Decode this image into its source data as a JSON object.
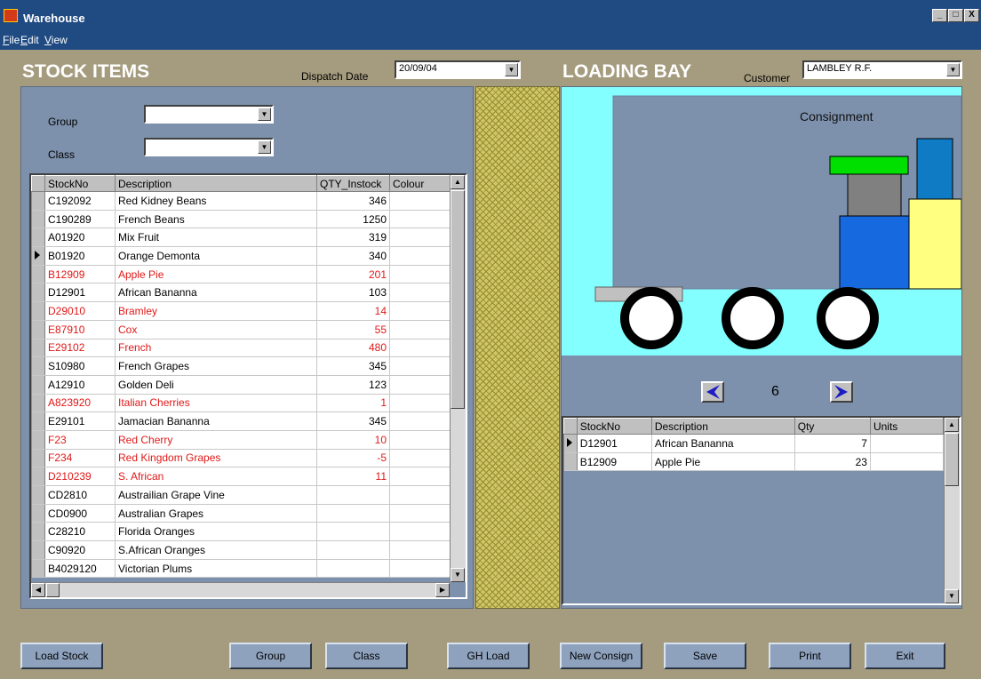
{
  "window": {
    "title": "Warehouse",
    "controls": [
      "_",
      "□",
      "X"
    ]
  },
  "menu": [
    {
      "label": "File",
      "accel": "F",
      "rest": "ile"
    },
    {
      "label": "Edit",
      "accel": "E",
      "rest": "dit"
    },
    {
      "label": "View",
      "accel": "V",
      "rest": "iew"
    }
  ],
  "stock": {
    "heading": "STOCK ITEMS",
    "dispatch_label": "Dispatch Date",
    "dispatch_value": "20/09/04",
    "group_label": "Group",
    "group_value": "",
    "class_label": "Class",
    "class_value": "",
    "columns": [
      "StockNo",
      "Description",
      "QTY_Instock",
      "Colour"
    ],
    "selected_row": 3,
    "rows": [
      {
        "stockno": "C192092",
        "description": "Red Kidney Beans",
        "qty": "346",
        "red": false
      },
      {
        "stockno": "C190289",
        "description": "French Beans",
        "qty": "1250",
        "red": false
      },
      {
        "stockno": "A01920",
        "description": "Mix Fruit",
        "qty": "319",
        "red": false
      },
      {
        "stockno": "B01920",
        "description": "Orange Demonta",
        "qty": "340",
        "red": false
      },
      {
        "stockno": "B12909",
        "description": "Apple Pie",
        "qty": "201",
        "red": true
      },
      {
        "stockno": "D12901",
        "description": "African Bananna",
        "qty": "103",
        "red": false
      },
      {
        "stockno": "D29010",
        "description": "Bramley",
        "qty": "14",
        "red": true
      },
      {
        "stockno": "E87910",
        "description": "Cox",
        "qty": "55",
        "red": true
      },
      {
        "stockno": "E29102",
        "description": "French",
        "qty": "480",
        "red": true
      },
      {
        "stockno": "S10980",
        "description": "French Grapes",
        "qty": "345",
        "red": false
      },
      {
        "stockno": "A12910",
        "description": "Golden Deli",
        "qty": "123",
        "red": false
      },
      {
        "stockno": "A823920",
        "description": "Italian Cherries",
        "qty": "1",
        "red": true
      },
      {
        "stockno": "E29101",
        "description": "Jamacian Bananna",
        "qty": "345",
        "red": false
      },
      {
        "stockno": "F23",
        "description": "Red Cherry",
        "qty": "10",
        "red": true
      },
      {
        "stockno": "F234",
        "description": "Red Kingdom Grapes",
        "qty": "-5",
        "red": true
      },
      {
        "stockno": "D210239",
        "description": "S. African",
        "qty": "11",
        "red": true
      },
      {
        "stockno": "CD2810",
        "description": "Austrailian Grape Vine",
        "qty": "",
        "red": false
      },
      {
        "stockno": "CD0900",
        "description": "Australian Grapes",
        "qty": "",
        "red": false
      },
      {
        "stockno": "C28210",
        "description": "Florida Oranges",
        "qty": "",
        "red": false
      },
      {
        "stockno": "C90920",
        "description": "S.African Oranges",
        "qty": "",
        "red": false
      },
      {
        "stockno": "B4029120",
        "description": "Victorian Plums",
        "qty": "",
        "red": false
      }
    ]
  },
  "loading": {
    "heading": "LOADING BAY",
    "customer_label": "Customer",
    "customer_value": "LAMBLEY R.F.",
    "consignment_label": "Consignment",
    "page_number": "6",
    "columns": [
      "StockNo",
      "Description",
      "Qty",
      "Units"
    ],
    "selected_row": 0,
    "rows": [
      {
        "stockno": "D12901",
        "description": "African Bananna",
        "qty": "7",
        "units": ""
      },
      {
        "stockno": "B12909",
        "description": "Apple Pie",
        "qty": "23",
        "units": ""
      }
    ]
  },
  "buttons": {
    "load_stock": "Load Stock",
    "group": "Group",
    "class": "Class",
    "gh_load": "GH Load",
    "new_consign": "New Consign",
    "save": "Save",
    "print": "Print",
    "exit": "Exit"
  },
  "colors": {
    "window_bg": "#a59b7e",
    "panel_bg": "#7d91ac",
    "titlebar": "#1f4a82",
    "alert_text": "#e01818",
    "truck_bg": "#84ffff"
  }
}
